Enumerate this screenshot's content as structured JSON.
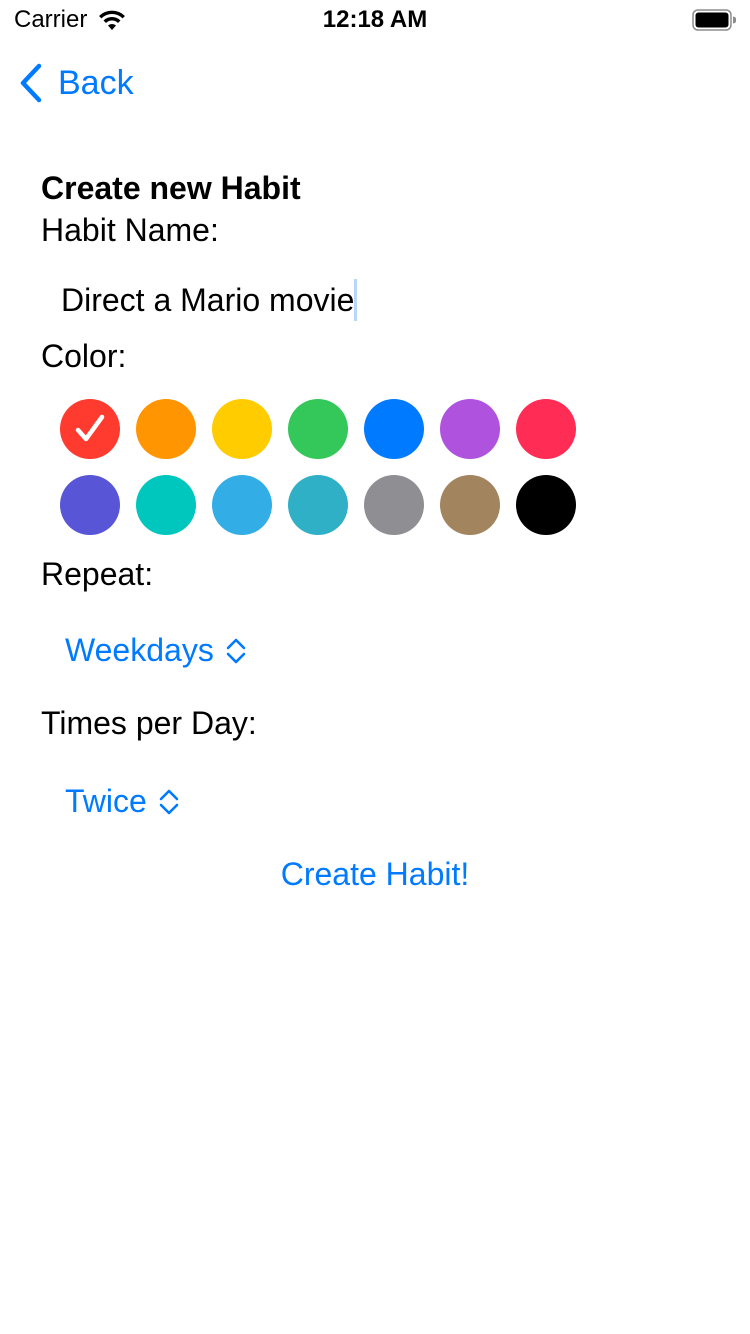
{
  "status_bar": {
    "carrier": "Carrier",
    "time": "12:18 AM",
    "wifi_icon": "wifi-icon",
    "battery_icon": "battery-icon"
  },
  "nav": {
    "back_label": "Back",
    "back_icon": "chevron-left-icon"
  },
  "form": {
    "title": "Create new Habit",
    "habit_name_label": "Habit Name:",
    "habit_name_value": "Direct a Mario movie",
    "color_label": "Color:",
    "colors": [
      [
        "#ff3b30",
        "#ff9500",
        "#ffcc00",
        "#34c759",
        "#007aff",
        "#af52de",
        "#ff2d55"
      ],
      [
        "#5856d6",
        "#00c7be",
        "#32ade6",
        "#30b0c7",
        "#8e8e93",
        "#a2845e",
        "#000000"
      ]
    ],
    "selected_color": "#ff3b30",
    "repeat_label": "Repeat:",
    "repeat_value": "Weekdays",
    "times_label": "Times per Day:",
    "times_value": "Twice",
    "create_button": "Create Habit!"
  },
  "accent_color": "#007aff"
}
